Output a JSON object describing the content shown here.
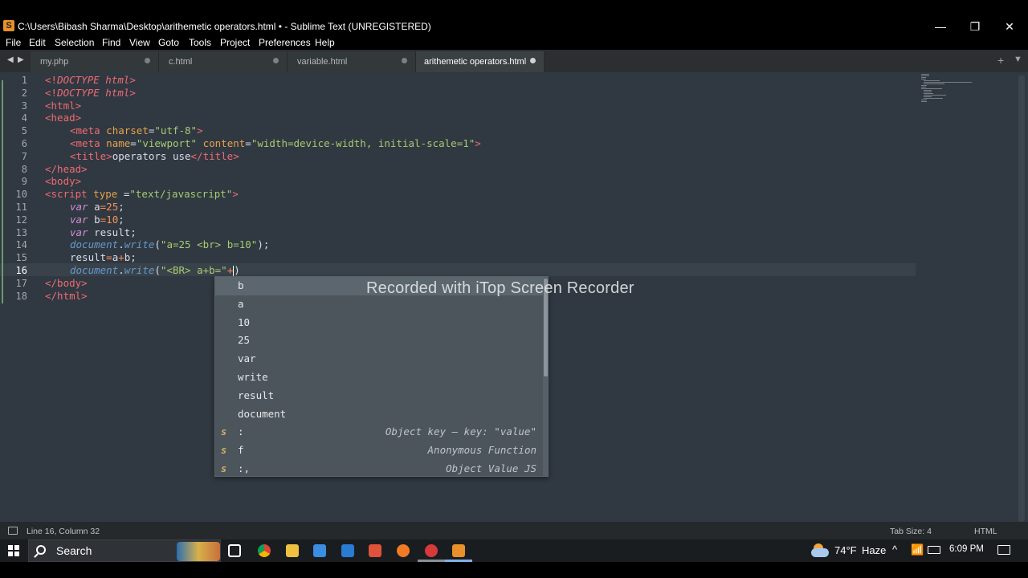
{
  "window": {
    "title": "C:\\Users\\Bibash Sharma\\Desktop\\arithemetic operators.html • - Sublime Text (UNREGISTERED)",
    "minimize": "—",
    "restore": "❐",
    "close": "✕"
  },
  "menu": [
    "File",
    "Edit",
    "Selection",
    "Find",
    "View",
    "Goto",
    "Tools",
    "Project",
    "Preferences",
    "Help"
  ],
  "tabs": [
    {
      "label": "my.php"
    },
    {
      "label": "c.html"
    },
    {
      "label": "variable.html"
    },
    {
      "label": "arithemetic operators.html"
    }
  ],
  "tab_controls": {
    "back": "◀",
    "forward": "▶",
    "new_tab": "+",
    "tab_menu": "▼"
  },
  "editor": {
    "line_numbers": [
      "1",
      "2",
      "3",
      "4",
      "5",
      "6",
      "7",
      "8",
      "9",
      "10",
      "11",
      "12",
      "13",
      "14",
      "15",
      "16",
      "17",
      "18"
    ],
    "current_line": 16,
    "code": {
      "l1": {
        "a": "<!",
        "b": "DOCTYPE",
        "c": " ",
        "d": "html",
        "e": ">"
      },
      "l2": {
        "a": "<!",
        "b": "DOCTYPE",
        "c": " ",
        "d": "html",
        "e": ">"
      },
      "l3": {
        "a": "<html>"
      },
      "l4": {
        "a": "<head>"
      },
      "l5": {
        "a": "<meta",
        "b": " charset",
        "c": "=",
        "d": "\"utf-8\"",
        "e": ">"
      },
      "l6": {
        "a": "<meta",
        "b": " name",
        "c": "=",
        "d": "\"viewport\"",
        "e": " content",
        "f": "=",
        "g": "\"width=device-width, initial-scale=1\"",
        "h": ">"
      },
      "l7": {
        "a": "<title>",
        "b": "operators use",
        "c": "</title>"
      },
      "l8": {
        "a": "</head>"
      },
      "l9": {
        "a": "<body>"
      },
      "l10": {
        "a": "<script",
        "b": " type ",
        "c": "=",
        "d": "\"text/javascript\"",
        "e": ">"
      },
      "l11": {
        "a": "var",
        "b": " a",
        "c": "=",
        "d": "25",
        "e": ";"
      },
      "l12": {
        "a": "var",
        "b": " b",
        "c": "=",
        "d": "10",
        "e": ";"
      },
      "l13": {
        "a": "var",
        "b": " result;"
      },
      "l14": {
        "a": "document",
        "b": ".",
        "c": "write",
        "d": "(",
        "e": "\"a=25 <br> b=10\"",
        "f": ");"
      },
      "l15": {
        "a": "result",
        "b": "=",
        "c": "a",
        "d": "+",
        "e": "b;"
      },
      "l16": {
        "a": "document",
        "b": ".",
        "c": "write",
        "d": "(",
        "e": "\"<BR> a+b=\"",
        "f": "+",
        "g": ")"
      },
      "l17": {
        "a": "</body>"
      },
      "l18": {
        "a": "</html>"
      }
    }
  },
  "autocomplete": {
    "items": [
      {
        "kind": "",
        "label": "b",
        "annotation": ""
      },
      {
        "kind": "",
        "label": "a",
        "annotation": ""
      },
      {
        "kind": "",
        "label": "10",
        "annotation": ""
      },
      {
        "kind": "",
        "label": "25",
        "annotation": ""
      },
      {
        "kind": "",
        "label": "var",
        "annotation": ""
      },
      {
        "kind": "",
        "label": "write",
        "annotation": ""
      },
      {
        "kind": "",
        "label": "result",
        "annotation": ""
      },
      {
        "kind": "",
        "label": "document",
        "annotation": ""
      },
      {
        "kind": "s",
        "label": ":",
        "annotation": "Object key — key: \"value\""
      },
      {
        "kind": "s",
        "label": "f",
        "annotation": "Anonymous Function"
      },
      {
        "kind": "s",
        "label": ":,",
        "annotation": "Object Value JS"
      }
    ],
    "selected_index": 0
  },
  "watermark": "Recorded with iTop Screen Recorder",
  "statusbar": {
    "position": "Line 16, Column 32",
    "tab_size": "Tab Size: 4",
    "syntax": "HTML"
  },
  "taskbar": {
    "search_label": "Search",
    "weather": "74°F",
    "weather_desc": "Haze",
    "time": "6:09 PM",
    "tray_chevron": "^"
  },
  "colors": {
    "editor_bg": "#303841",
    "tag": "#ef6b73",
    "string": "#a6cc70",
    "attribute": "#e8a24a",
    "keyword": "#d08fd5",
    "popup_bg": "#4c555c"
  }
}
